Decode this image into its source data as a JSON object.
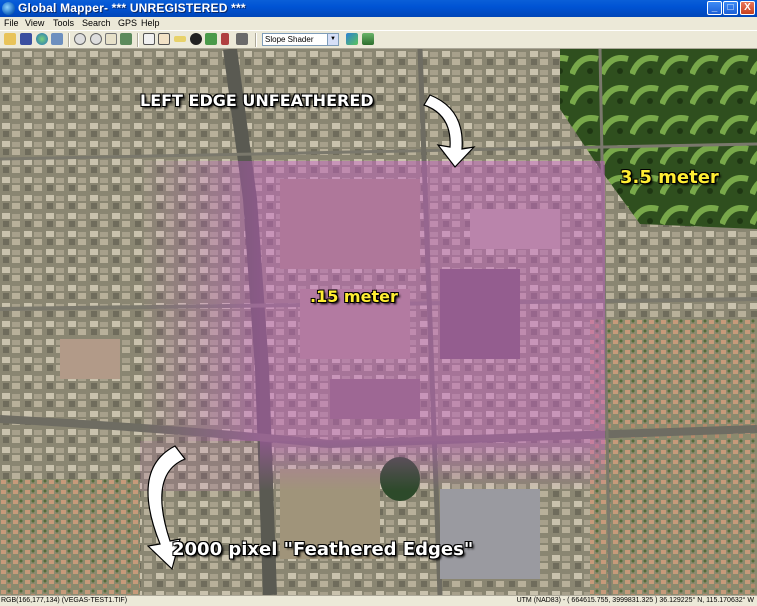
{
  "window": {
    "title": "Global Mapper- *** UNREGISTERED ***",
    "minimize_glyph": "_",
    "maximize_glyph": "□",
    "close_glyph": "X"
  },
  "menu": {
    "items": [
      "File",
      "View",
      "Tools",
      "Search",
      "GPS",
      "Help"
    ]
  },
  "toolbar": {
    "shader_selected": "Slope Shader",
    "buttons": [
      "open-folder-icon",
      "save-icon",
      "globe-icon",
      "config-icon",
      "zoom-in-icon",
      "zoom-out-icon",
      "home-icon",
      "measure-icon",
      "select-icon",
      "pan-hand-icon",
      "ruler-icon",
      "info-icon",
      "image-icon",
      "digitizer-icon",
      "path-profile-icon"
    ],
    "extra_buttons": [
      "shader-palette-icon",
      "3d-view-icon"
    ]
  },
  "map": {
    "annotations": {
      "left_edge": "LEFT EDGE UNFEATHERED",
      "resolution_coarse": "3.5 meter",
      "resolution_fine": ".15 meter",
      "feathered": "2000 pixel \"Feathered Edges\""
    }
  },
  "status": {
    "left": "RGB(166,177,134) (VEGAS-TEST1.TIF)",
    "right": "UTM (NAD83) - ( 664615.755, 3999831.325 ) 36.129225° N, 115.170632° W"
  },
  "colors": {
    "title_bar": "#0053d4",
    "menu_background": "#ece9d8",
    "overlay_tint": "#c860c8",
    "label_yellow": "#ffee33"
  }
}
